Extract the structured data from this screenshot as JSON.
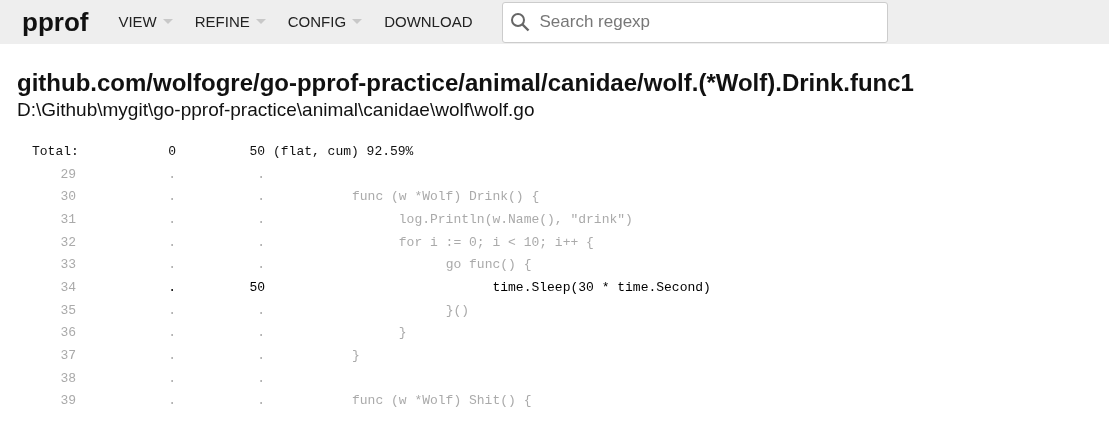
{
  "header": {
    "logo": "pprof",
    "menu": [
      {
        "label": "VIEW",
        "dropdown": true
      },
      {
        "label": "REFINE",
        "dropdown": true
      },
      {
        "label": "CONFIG",
        "dropdown": true
      },
      {
        "label": "DOWNLOAD",
        "dropdown": false
      }
    ],
    "search": {
      "placeholder": "Search regexp"
    }
  },
  "function": {
    "name": "github.com/wolfogre/go-pprof-practice/animal/canidae/wolf.(*Wolf).Drink.func1",
    "file": "D:\\Github\\mygit\\go-pprof-practice\\animal\\canidae\\wolf\\wolf.go"
  },
  "total": {
    "label": "Total:",
    "flat": "0",
    "cum": "50",
    "summary": "(flat, cum) 92.59%"
  },
  "lines": [
    {
      "number": "29",
      "flat": ".",
      "cum": ".",
      "hot": false
    },
    {
      "number": "30",
      "flat": ".",
      "cum": ".",
      "code": "func (w *Wolf) Drink() {",
      "hot": false
    },
    {
      "number": "31",
      "flat": ".",
      "cum": ".",
      "code": "\tlog.Println(w.Name(), \"drink\")",
      "hot": false
    },
    {
      "number": "32",
      "flat": ".",
      "cum": ".",
      "code": "\tfor i := 0; i < 10; i++ {",
      "hot": false
    },
    {
      "number": "33",
      "flat": ".",
      "cum": ".",
      "code": "\t\tgo func() {",
      "hot": false
    },
    {
      "number": "34",
      "flat": ".",
      "cum": "50",
      "code": "\t\t\ttime.Sleep(30 * time.Second)",
      "hot": true
    },
    {
      "number": "35",
      "flat": ".",
      "cum": ".",
      "code": "\t\t}()",
      "hot": false
    },
    {
      "number": "36",
      "flat": ".",
      "cum": ".",
      "code": "\t}",
      "hot": false
    },
    {
      "number": "37",
      "flat": ".",
      "cum": ".",
      "code": "}",
      "hot": false
    },
    {
      "number": "38",
      "flat": ".",
      "cum": ".",
      "hot": false
    },
    {
      "number": "39",
      "flat": ".",
      "cum": ".",
      "code": "func (w *Wolf) Shit() {",
      "hot": false
    }
  ]
}
